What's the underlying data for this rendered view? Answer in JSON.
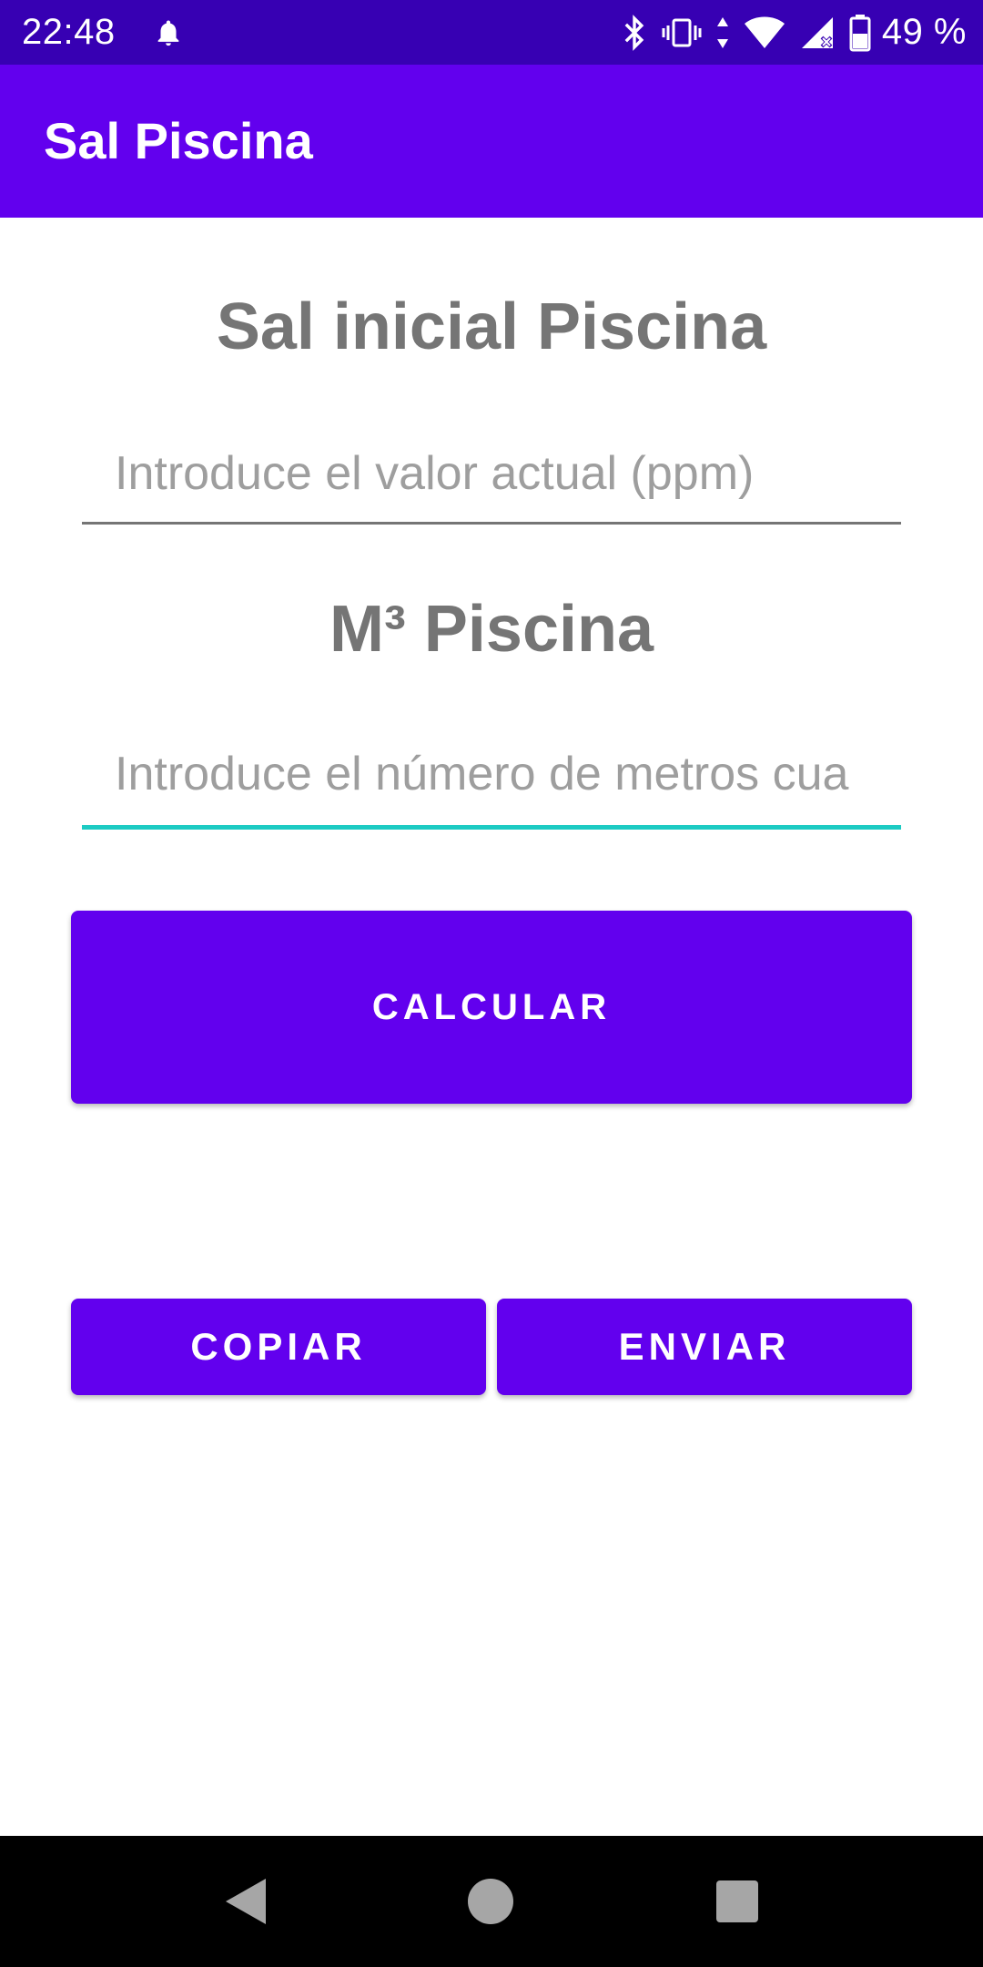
{
  "status_bar": {
    "time": "22:48",
    "battery_percent": "49 %",
    "icons": [
      "notification-bell-icon",
      "bluetooth-icon",
      "vibrate-icon",
      "data-arrows-icon",
      "wifi-icon",
      "cell-signal-icon",
      "battery-icon"
    ]
  },
  "app_bar": {
    "title": "Sal Piscina"
  },
  "form": {
    "salt_title": "Sal inicial Piscina",
    "salt_input": {
      "value": "",
      "placeholder": "Introduce el valor actual (ppm)"
    },
    "volume_title": "M³ Piscina",
    "volume_input": {
      "value": "",
      "placeholder": "Introduce el número de metros cua"
    }
  },
  "buttons": {
    "calcular": "CALCULAR",
    "copiar": "COPIAR",
    "enviar": "ENVIAR"
  },
  "nav_bar": {
    "icons": [
      "back-icon",
      "home-icon",
      "recents-icon"
    ]
  },
  "colors": {
    "status_bar": "#3700b3",
    "app_bar": "#6200ee",
    "button": "#6200ee",
    "title_text": "#757575",
    "focused_underline": "#1ccbc3",
    "unfocused_underline": "#757575"
  }
}
